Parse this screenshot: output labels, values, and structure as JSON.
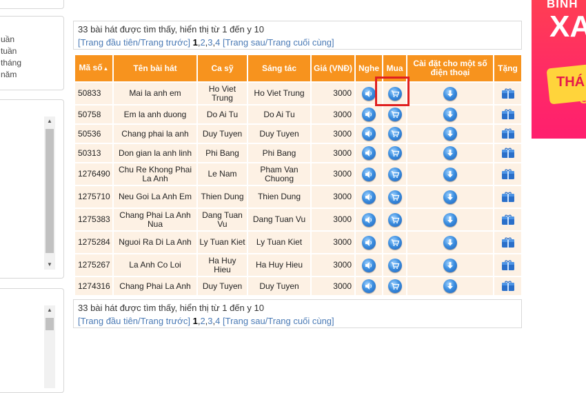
{
  "sidebar": {
    "filter_items": [
      "uần",
      "tuần",
      "tháng",
      "năm"
    ]
  },
  "results": {
    "summary": "33 bài hát được tìm thấy, hiển thị từ 1 đến y 10",
    "first_prev": "[Trang đầu tiên/Trang trước]",
    "pages": [
      "1",
      "2",
      "3",
      "4"
    ],
    "next_last": "[Trang sau/Trang cuối cùng]"
  },
  "table": {
    "headers": {
      "code": "Mã số",
      "title": "Tên bài hát",
      "singer": "Ca sỹ",
      "composer": "Sáng tác",
      "price": "Giá (VNĐ)",
      "listen": "Nghe",
      "buy": "Mua",
      "install": "Cài đặt cho một số điện thoại",
      "gift": "Tặng"
    },
    "rows": [
      {
        "code": "50833",
        "title": "Mai la anh em",
        "singer": "Ho Viet Trung",
        "composer": "Ho Viet Trung",
        "price": "3000"
      },
      {
        "code": "50758",
        "title": "Em la anh duong",
        "singer": "Do Ai Tu",
        "composer": "Do Ai Tu",
        "price": "3000"
      },
      {
        "code": "50536",
        "title": "Chang phai la anh",
        "singer": "Duy Tuyen",
        "composer": "Duy Tuyen",
        "price": "3000"
      },
      {
        "code": "50313",
        "title": "Don gian la anh linh",
        "singer": "Phi Bang",
        "composer": "Phi Bang",
        "price": "3000"
      },
      {
        "code": "1276490",
        "title": "Chu Re Khong Phai La Anh",
        "singer": "Le Nam",
        "composer": "Pham Van Chuong",
        "price": "3000"
      },
      {
        "code": "1275710",
        "title": "Neu Goi La Anh Em",
        "singer": "Thien Dung",
        "composer": "Thien Dung",
        "price": "3000"
      },
      {
        "code": "1275383",
        "title": "Chang Phai La Anh Nua",
        "singer": "Dang Tuan Vu",
        "composer": "Dang Tuan Vu",
        "price": "3000"
      },
      {
        "code": "1275284",
        "title": "Nguoi Ra Di La Anh",
        "singer": "Ly Tuan Kiet",
        "composer": "Ly Tuan Kiet",
        "price": "3000"
      },
      {
        "code": "1275267",
        "title": "La Anh Co Loi",
        "singer": "Ha Huy Hieu",
        "composer": "Ha Huy Hieu",
        "price": "3000"
      },
      {
        "code": "1274316",
        "title": "Chang Phai La Anh",
        "singer": "Duy Tuyen",
        "composer": "Duy Tuyen",
        "price": "3000"
      }
    ],
    "icons": {
      "listen": "speaker-icon",
      "buy": "cart-icon",
      "install": "download-icon",
      "gift": "gift-icon"
    }
  },
  "ad": {
    "line1": "BINH",
    "line2": "XA",
    "line3": "THÁ",
    "line4": "S"
  },
  "colors": {
    "header_bg": "#f7931e",
    "row_bg": "#fdf1e4",
    "highlight": "#e02020",
    "link": "#4a7ab5"
  }
}
